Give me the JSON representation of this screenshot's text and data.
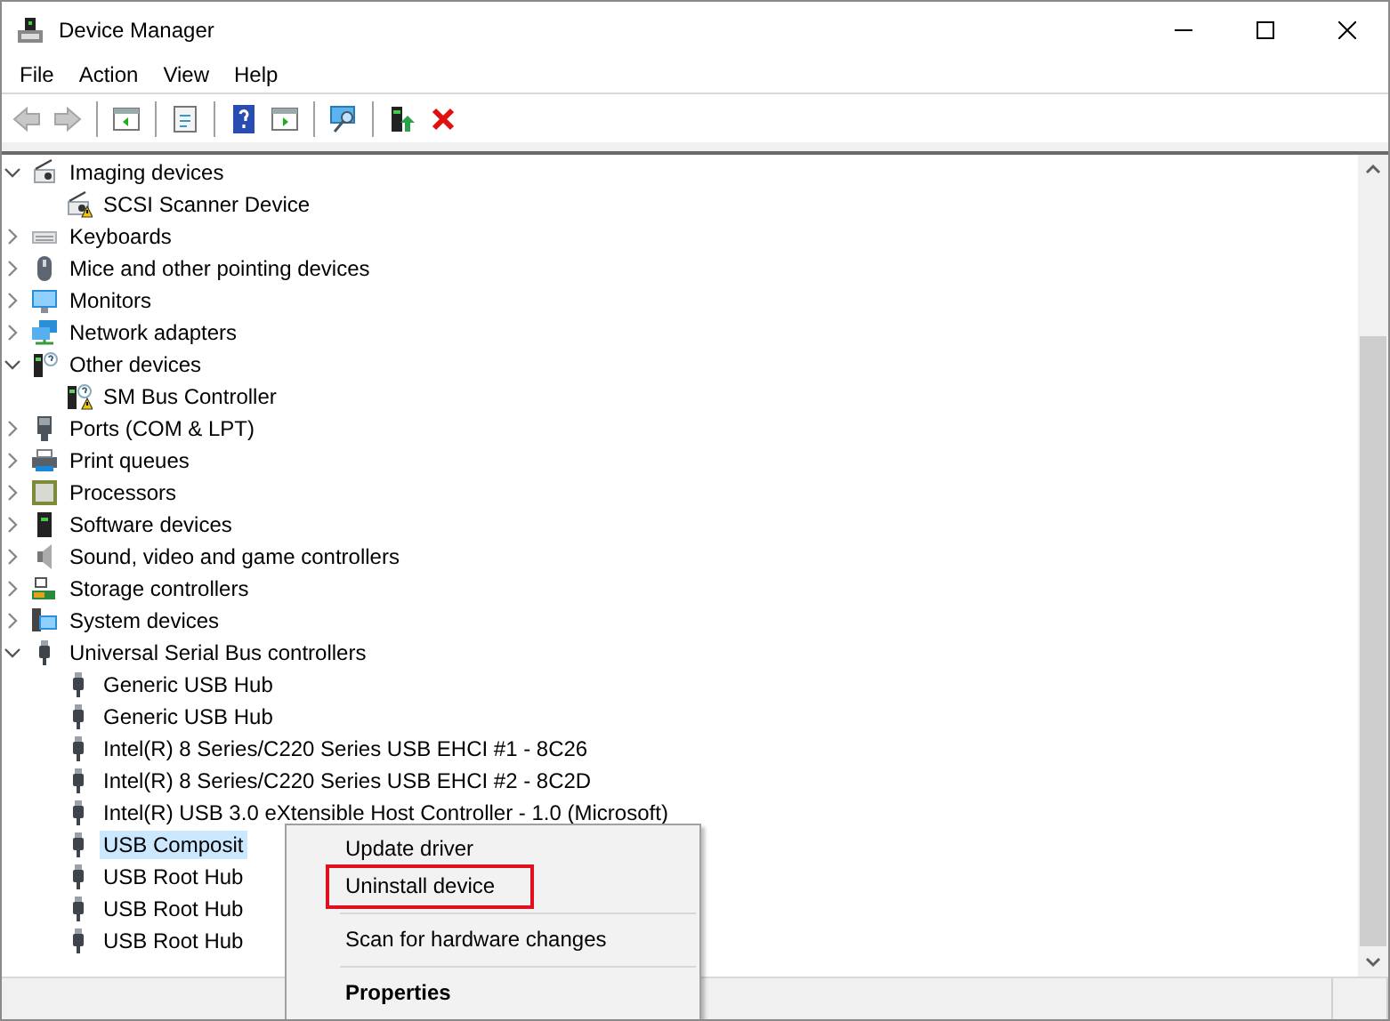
{
  "window": {
    "title": "Device Manager"
  },
  "menu_bar": [
    "File",
    "Action",
    "View",
    "Help"
  ],
  "toolbar": [
    {
      "kind": "back",
      "disabled": true
    },
    {
      "kind": "forward",
      "disabled": true
    },
    {
      "kind": "separator"
    },
    {
      "kind": "console-tree",
      "disabled": false
    },
    {
      "kind": "separator"
    },
    {
      "kind": "properties",
      "disabled": false
    },
    {
      "kind": "separator"
    },
    {
      "kind": "help",
      "disabled": false
    },
    {
      "kind": "action-pane",
      "disabled": false
    },
    {
      "kind": "separator"
    },
    {
      "kind": "scan",
      "disabled": false
    },
    {
      "kind": "separator"
    },
    {
      "kind": "update-driver",
      "disabled": false
    },
    {
      "kind": "uninstall",
      "disabled": false
    }
  ],
  "tree": [
    {
      "label": "Imaging devices",
      "kind": "camera",
      "expanded": true,
      "selected": false,
      "children": [
        {
          "label": "SCSI Scanner Device",
          "kind": "camera",
          "warning": true,
          "selected": false
        }
      ]
    },
    {
      "label": "Keyboards",
      "kind": "keyboard",
      "expanded": false,
      "selected": false
    },
    {
      "label": "Mice and other pointing devices",
      "kind": "mouse",
      "expanded": false,
      "selected": false
    },
    {
      "label": "Monitors",
      "kind": "monitor",
      "expanded": false,
      "selected": false
    },
    {
      "label": "Network adapters",
      "kind": "network",
      "expanded": false,
      "selected": false
    },
    {
      "label": "Other devices",
      "kind": "unknown",
      "expanded": true,
      "selected": false,
      "children": [
        {
          "label": "SM Bus Controller",
          "kind": "unknown",
          "warning": true,
          "selected": false
        }
      ]
    },
    {
      "label": "Ports (COM & LPT)",
      "kind": "port",
      "expanded": false,
      "selected": false
    },
    {
      "label": "Print queues",
      "kind": "printer",
      "expanded": false,
      "selected": false
    },
    {
      "label": "Processors",
      "kind": "chip",
      "expanded": false,
      "selected": false
    },
    {
      "label": "Software devices",
      "kind": "tower",
      "expanded": false,
      "selected": false
    },
    {
      "label": "Sound, video and game controllers",
      "kind": "speaker",
      "expanded": false,
      "selected": false
    },
    {
      "label": "Storage controllers",
      "kind": "storage",
      "expanded": false,
      "selected": false
    },
    {
      "label": "System devices",
      "kind": "system",
      "expanded": false,
      "selected": false
    },
    {
      "label": "Universal Serial Bus controllers",
      "kind": "usb",
      "expanded": true,
      "selected": false,
      "children": [
        {
          "label": "Generic USB Hub",
          "kind": "usb",
          "warning": false,
          "selected": false
        },
        {
          "label": "Generic USB Hub",
          "kind": "usb",
          "warning": false,
          "selected": false
        },
        {
          "label": "Intel(R) 8 Series/C220 Series USB EHCI #1 - 8C26",
          "kind": "usb",
          "warning": false,
          "selected": false
        },
        {
          "label": "Intel(R) 8 Series/C220 Series USB EHCI #2 - 8C2D",
          "kind": "usb",
          "warning": false,
          "selected": false
        },
        {
          "label": "Intel(R) USB 3.0 eXtensible Host Controller - 1.0 (Microsoft)",
          "kind": "usb",
          "warning": false,
          "selected": false
        },
        {
          "label": "USB Composit",
          "kind": "usb",
          "warning": false,
          "selected": true
        },
        {
          "label": "USB Root Hub",
          "kind": "usb",
          "warning": false,
          "selected": false
        },
        {
          "label": "USB Root Hub",
          "kind": "usb",
          "warning": false,
          "selected": false
        },
        {
          "label": "USB Root Hub",
          "kind": "usb",
          "warning": false,
          "selected": false
        }
      ]
    }
  ],
  "context_menu": [
    {
      "label": "Update driver",
      "default": false,
      "highlighted": false,
      "separator_before": false
    },
    {
      "label": "Uninstall device",
      "default": false,
      "highlighted": true,
      "separator_before": false
    },
    {
      "label": "Scan for hardware changes",
      "default": false,
      "highlighted": false,
      "separator_before": true
    },
    {
      "label": "Properties",
      "default": true,
      "highlighted": false,
      "separator_before": true
    }
  ]
}
